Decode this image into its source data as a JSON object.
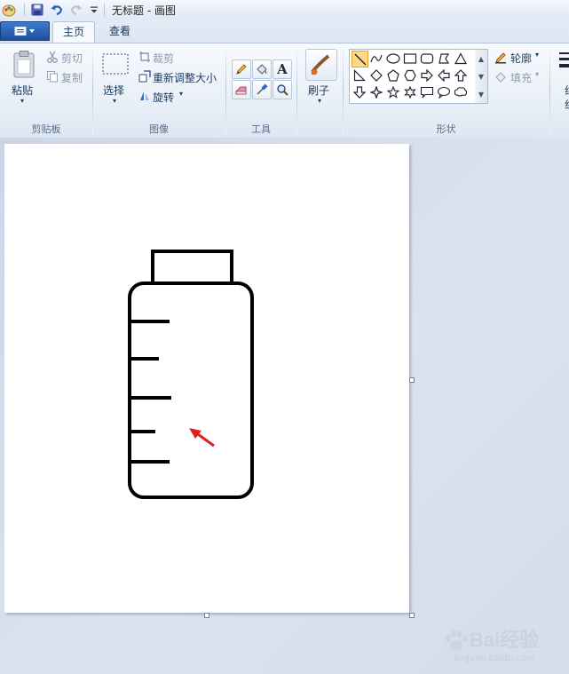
{
  "window": {
    "title": "无标题 - 画图"
  },
  "tabs": [
    {
      "label": "主页",
      "active": true
    },
    {
      "label": "查看",
      "active": false
    }
  ],
  "clipboard": {
    "paste_label": "粘贴",
    "cut_label": "剪切",
    "copy_label": "复制",
    "group_label": "剪贴板"
  },
  "image": {
    "select_label": "选择",
    "crop_label": "裁剪",
    "resize_label": "重新调整大小",
    "rotate_label": "旋转",
    "group_label": "图像"
  },
  "tools": {
    "group_label": "工具",
    "items": [
      "pencil-icon",
      "fill-bucket-icon",
      "text-icon",
      "eraser-icon",
      "color-picker-icon",
      "magnifier-icon"
    ],
    "text_glyph": "A"
  },
  "brushes": {
    "label": "刷子"
  },
  "shapes": {
    "group_label": "形状",
    "outline_label": "轮廓",
    "fill_label": "填充",
    "selected": "line"
  },
  "size": {
    "partial_label": "线",
    "partial_label2": "组"
  },
  "canvas": {
    "background": "#ffffff",
    "drawing": "bottle with measurement marks",
    "stroke_color": "#000000",
    "arrow_color": "#e02020",
    "tick_marks": 5
  },
  "watermark": {
    "text": "Bai经验",
    "sub": "jingyan.baidu.com"
  },
  "colors": {
    "accent": "#1c4f9a",
    "ribbon": "#eaf0f8",
    "workspace": "#d6dfee"
  }
}
